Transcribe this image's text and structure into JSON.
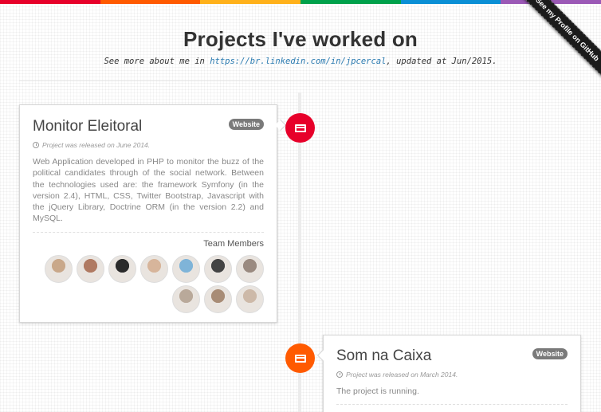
{
  "colors": {
    "bar": [
      "#e7002a",
      "#ff5a00",
      "#ffb11b",
      "#00a14b",
      "#0a8fd5",
      "#9b59b6"
    ],
    "node1": "#e7002a",
    "node2": "#ff5a00"
  },
  "ribbon": {
    "label": "See my Profile on GitHub"
  },
  "header": {
    "title": "Projects I've worked on",
    "subtitle_prefix": "See more about me in ",
    "link": "https://br.linkedin.com/in/jpcercal",
    "subtitle_suffix": ", updated at Jun/2015."
  },
  "projects": [
    {
      "title": "Monitor Eleitoral",
      "badge": "Website",
      "release": "Project was released on June 2014.",
      "description": "Web Application developed in PHP to monitor the buzz of the political candidates through of the social network. Between the technologies used are: the framework Symfony (in the version 2.4), HTML, CSS, Twitter Bootstrap, Javascript with the jQuery Library, Doctrine ORM (in the version 2.2) and MySQL.",
      "team_label": "Team Members",
      "node_icon": "credit-card-icon",
      "avatar_tones": [
        "#c9a88a",
        "#b07a62",
        "#2a2a2a",
        "#d7b59b",
        "#7fb4d8",
        "#444444",
        "#9a8a80",
        "#b9a99a",
        "#a88c76",
        "#cdb9a8"
      ]
    },
    {
      "title": "Som na Caixa",
      "badge": "Website",
      "release": "Project was released on March 2014.",
      "description": "The project is running.",
      "node_icon": "credit-card-icon"
    }
  ]
}
